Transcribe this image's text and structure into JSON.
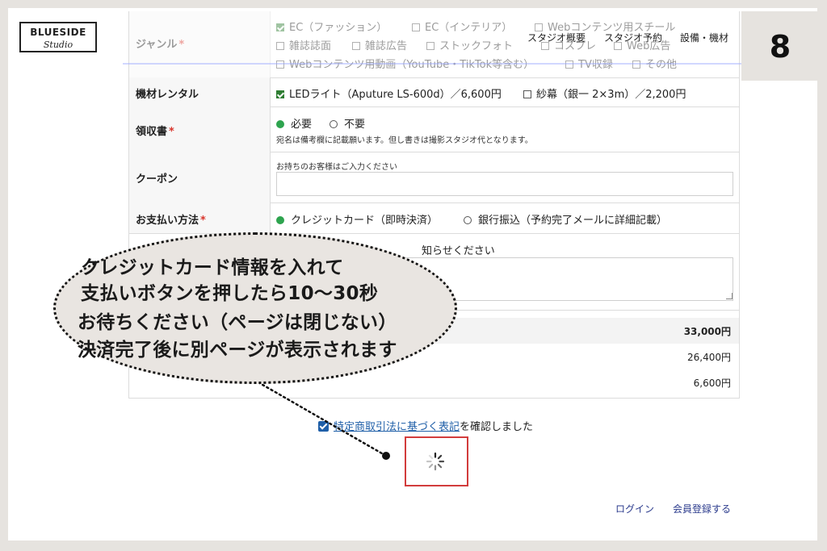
{
  "step_number": "8",
  "logo": {
    "line1": "BLUESIDE",
    "line2": "Studio"
  },
  "nav": {
    "item1": "スタジオ概要",
    "item2": "スタジオ予約",
    "item3": "設備・機材"
  },
  "form": {
    "genre": {
      "label": "ジャンル",
      "required_mark": "*",
      "options": [
        "EC（ファッション）",
        "EC（インテリア）",
        "Webコンテンツ用スチール",
        "雑誌誌面",
        "雑誌広告",
        "ストックフォト",
        "コスプレ",
        "Web広告",
        "Webコンテンツ用動画（YouTube・TikTok等含む）",
        "TV収録",
        "その他"
      ],
      "checked": [
        true,
        false,
        false,
        false,
        false,
        false,
        false,
        false,
        false,
        false,
        false
      ]
    },
    "equipment": {
      "label": "機材レンタル",
      "options": [
        "LEDライト（Aputure LS-600d）／6,600円",
        "紗幕（銀一 2×3m）／2,200円"
      ],
      "checked": [
        true,
        false
      ]
    },
    "receipt": {
      "label": "領収書",
      "required_mark": "*",
      "options": [
        "必要",
        "不要"
      ],
      "selected": 0,
      "note": "宛名は備考欄に記載願います。但し書きは撮影スタジオ代となります。"
    },
    "coupon": {
      "label": "クーポン",
      "hint": "お持ちのお客様はご入力ください",
      "value": ""
    },
    "payment": {
      "label": "お支払い方法",
      "required_mark": "*",
      "options": [
        "クレジットカード（即時決済）",
        "銀行振込（予約完了メールに詳細記載）"
      ],
      "selected": 0
    },
    "remarks": {
      "hint_visible": "知らせください",
      "value": ""
    },
    "prices": [
      "33,000円",
      "26,400円",
      "6,600円"
    ]
  },
  "terms": {
    "link_text": "特定商取引法に基づく表記",
    "suffix": "を確認しました",
    "checked": true
  },
  "footer": {
    "login": "ログイン",
    "register": "会員登録する"
  },
  "bubble": {
    "lines": [
      "クレジットカード情報を入れて",
      "支払いボタンを押したら10〜30秒",
      "お待ちください（ページは閉じない）",
      "決済完了後に別ページが表示されます"
    ]
  },
  "colors": {
    "accent_green": "#2ea44f",
    "required_red": "#d9342b",
    "link_blue": "#1f5fa8",
    "highlight_red": "#d23c3c",
    "bubble_fill": "#e9e5e1",
    "background": "#e6e3df"
  },
  "icons": {
    "loading": "loading-spinner-icon"
  }
}
